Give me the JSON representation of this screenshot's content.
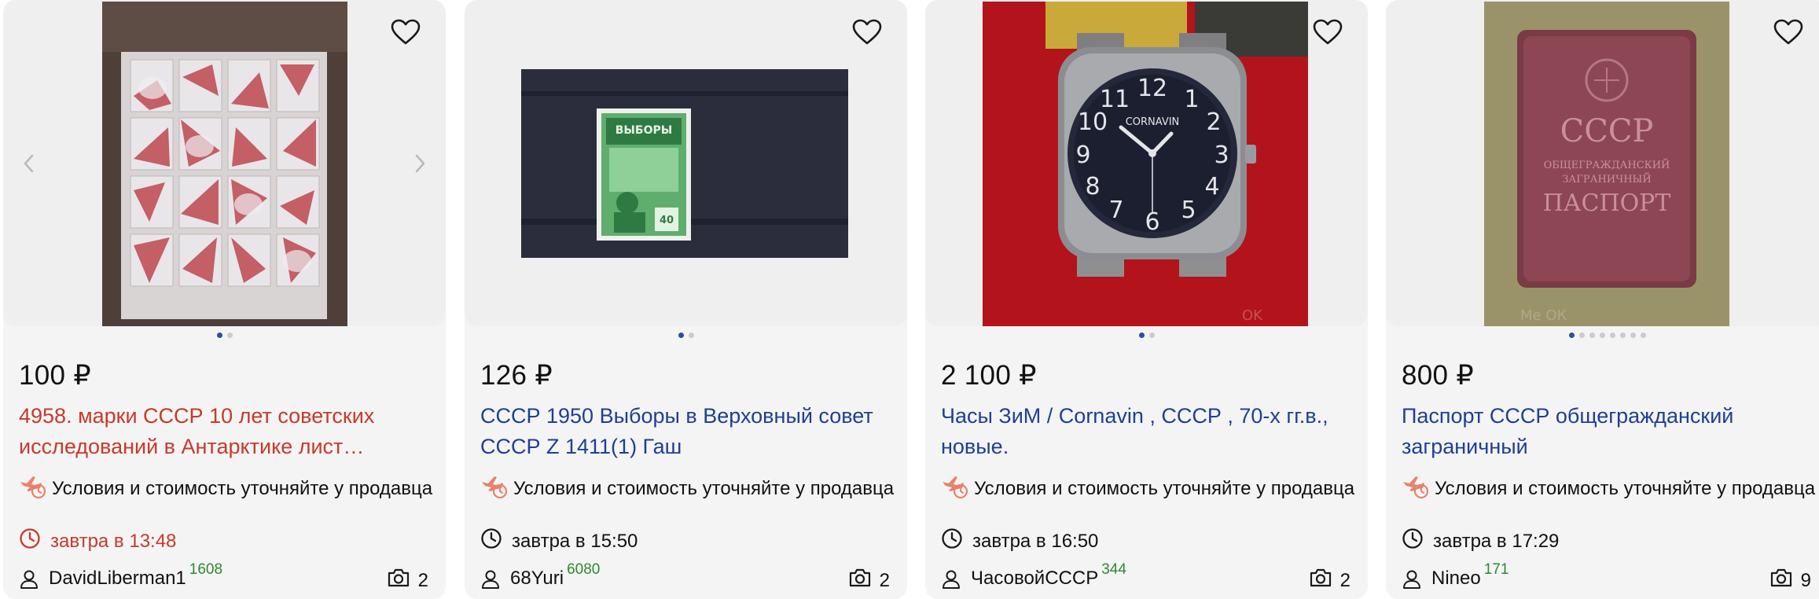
{
  "colors": {
    "title_link": "#1e3f94",
    "title_highlight": "#c8392b",
    "dot_active": "#2b4fa0",
    "seller_score": "#2d8a2d",
    "card_bg": "#f4f4f5"
  },
  "cards": [
    {
      "price": "100 ₽",
      "title": "4958. марки СССР 10 лет советских исследований в Антарктике лист…",
      "title_color": "red",
      "delivery": "Условия и стоимость уточняйте у продавца",
      "time": "завтра в 13:48",
      "time_color": "red",
      "seller": "DavidLiberman1",
      "seller_score": "1608",
      "photo_count": "2",
      "dots_total": 2,
      "dots_active": 1,
      "has_arrows": true,
      "icons": [
        "heart-icon",
        "plane-clock-icon",
        "clock-icon",
        "person-icon",
        "camera-icon"
      ]
    },
    {
      "price": "126 ₽",
      "title": "СССР 1950 Выборы в Верховный совет СССР Z 1411(1) Гаш",
      "title_color": "blue",
      "delivery": "Условия и стоимость уточняйте у продавца",
      "time": "завтра в 15:50",
      "time_color": "black",
      "seller": "68Yuri",
      "seller_score": "6080",
      "photo_count": "2",
      "dots_total": 2,
      "dots_active": 1,
      "has_arrows": false
    },
    {
      "price": "2 100 ₽",
      "title": "Часы ЗиМ / Cornavin , СССР , 70-х гг.в., новые.",
      "title_color": "blue",
      "delivery": "Условия и стоимость уточняйте у продавца",
      "time": "завтра в 16:50",
      "time_color": "black",
      "seller": "ЧасовойСССР",
      "seller_score": "344",
      "photo_count": "2",
      "dots_total": 2,
      "dots_active": 1,
      "has_arrows": false
    },
    {
      "price": "800 ₽",
      "title": "Паспорт СССР общегражданский заграничный",
      "title_color": "blue",
      "delivery": "Условия и стоимость уточняйте у продавца",
      "time": "завтра в 17:29",
      "time_color": "black",
      "seller": "Nineo",
      "seller_score": "171",
      "photo_count": "9",
      "dots_total": 8,
      "dots_active": 1,
      "has_arrows": false
    }
  ]
}
